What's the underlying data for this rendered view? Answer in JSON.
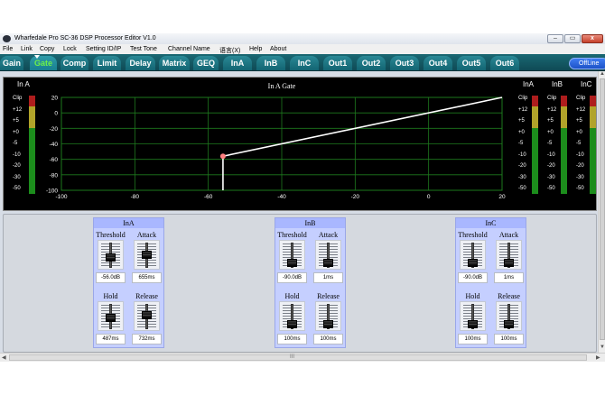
{
  "window": {
    "title": "Wharfedale Pro SC-36 DSP Processor Editor V1.0",
    "controls": {
      "minimize": "–",
      "maximize": "▭",
      "close": "x"
    }
  },
  "menu": [
    "File",
    "Link",
    "Copy",
    "Lock",
    "Setting ID/IP",
    "Test Tone",
    "Channel Name",
    "语言(X)",
    "Help",
    "About"
  ],
  "tabs": [
    "Gain",
    "Gate",
    "Comp",
    "Limit",
    "Delay",
    "Matrix",
    "GEQ",
    "InA",
    "InB",
    "InC",
    "Out1",
    "Out2",
    "Out3",
    "Out4",
    "Out5",
    "Out6"
  ],
  "active_tab": "Gate",
  "offline_label": "OffLine",
  "graph": {
    "title": "In A  Gate",
    "left_meter_label": "In A",
    "right_meter_labels": [
      "InA",
      "InB",
      "InC"
    ],
    "meter_scale": [
      "Clip",
      "+12",
      "+5",
      "+0",
      "-5",
      "-10",
      "-20",
      "-30",
      "-50"
    ],
    "accent_color": "#ff7f7f"
  },
  "chart_data": {
    "type": "line",
    "title": "In A  Gate",
    "xlim": [
      -100,
      20
    ],
    "ylim": [
      -100,
      20
    ],
    "x_ticks": [
      -100,
      -80,
      -60,
      -40,
      -20,
      0,
      20
    ],
    "y_ticks": [
      20,
      0,
      -20,
      -40,
      -60,
      -80,
      -100
    ],
    "grid": true,
    "threshold": -56,
    "series": [
      {
        "points": [
          [
            -56,
            -100
          ],
          [
            -56,
            -56
          ],
          [
            20,
            20
          ]
        ],
        "color": "#ffffff"
      }
    ]
  },
  "channels": [
    {
      "name": "InA",
      "threshold": {
        "label": "Threshold",
        "value": "-56.0dB",
        "level": 0.4
      },
      "attack": {
        "label": "Attack",
        "value": "655ms",
        "level": 0.55
      },
      "hold": {
        "label": "Hold",
        "value": "487ms",
        "level": 0.45
      },
      "release": {
        "label": "Release",
        "value": "732ms",
        "level": 0.6
      }
    },
    {
      "name": "InB",
      "threshold": {
        "label": "Threshold",
        "value": "-90.0dB",
        "level": 0.1
      },
      "attack": {
        "label": "Attack",
        "value": "1ms",
        "level": 0.08
      },
      "hold": {
        "label": "Hold",
        "value": "100ms",
        "level": 0.12
      },
      "release": {
        "label": "Release",
        "value": "100ms",
        "level": 0.12
      }
    },
    {
      "name": "InC",
      "threshold": {
        "label": "Threshold",
        "value": "-90.0dB",
        "level": 0.1
      },
      "attack": {
        "label": "Attack",
        "value": "1ms",
        "level": 0.08
      },
      "hold": {
        "label": "Hold",
        "value": "100ms",
        "level": 0.12
      },
      "release": {
        "label": "Release",
        "value": "100ms",
        "level": 0.12
      }
    }
  ],
  "scroll": {
    "h_thumb_label": "III"
  }
}
